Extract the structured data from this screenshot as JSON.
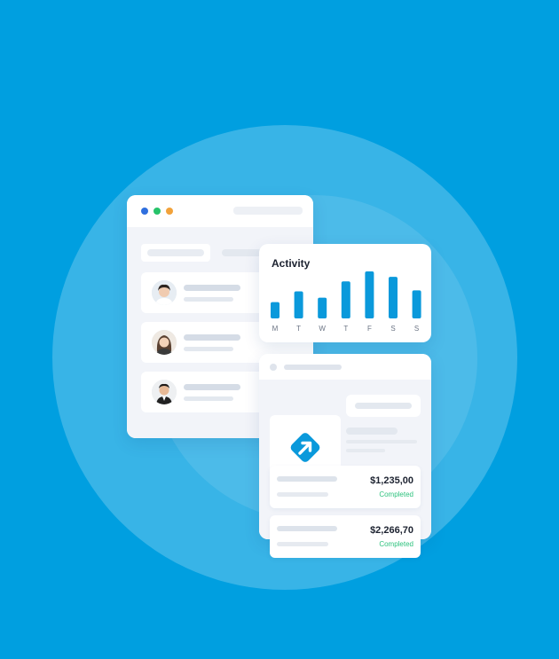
{
  "activity": {
    "title": "Activity"
  },
  "chart_data": {
    "type": "bar",
    "title": "Activity",
    "categories": [
      "M",
      "T",
      "W",
      "T",
      "F",
      "S",
      "S"
    ],
    "values": [
      18,
      30,
      23,
      41,
      52,
      46,
      31
    ],
    "ylim": [
      0,
      55
    ],
    "color": "#0a99db",
    "grid": false
  },
  "transactions": [
    {
      "amount": "$1,235,00",
      "status": "Completed"
    },
    {
      "amount": "$2,266,70",
      "status": "Completed"
    }
  ],
  "colors": {
    "background": "#009fe0",
    "accent": "#0a99db",
    "completed": "#2ec27e",
    "window_dot_blue": "#2f6fde",
    "window_dot_green": "#27c36a",
    "window_dot_orange": "#f2a23a"
  },
  "icons": {
    "window_dots": [
      "window-close-dot",
      "window-minimize-dot",
      "window-maximize-dot"
    ],
    "app_logo": "arrow-up-right-diamond-icon"
  }
}
